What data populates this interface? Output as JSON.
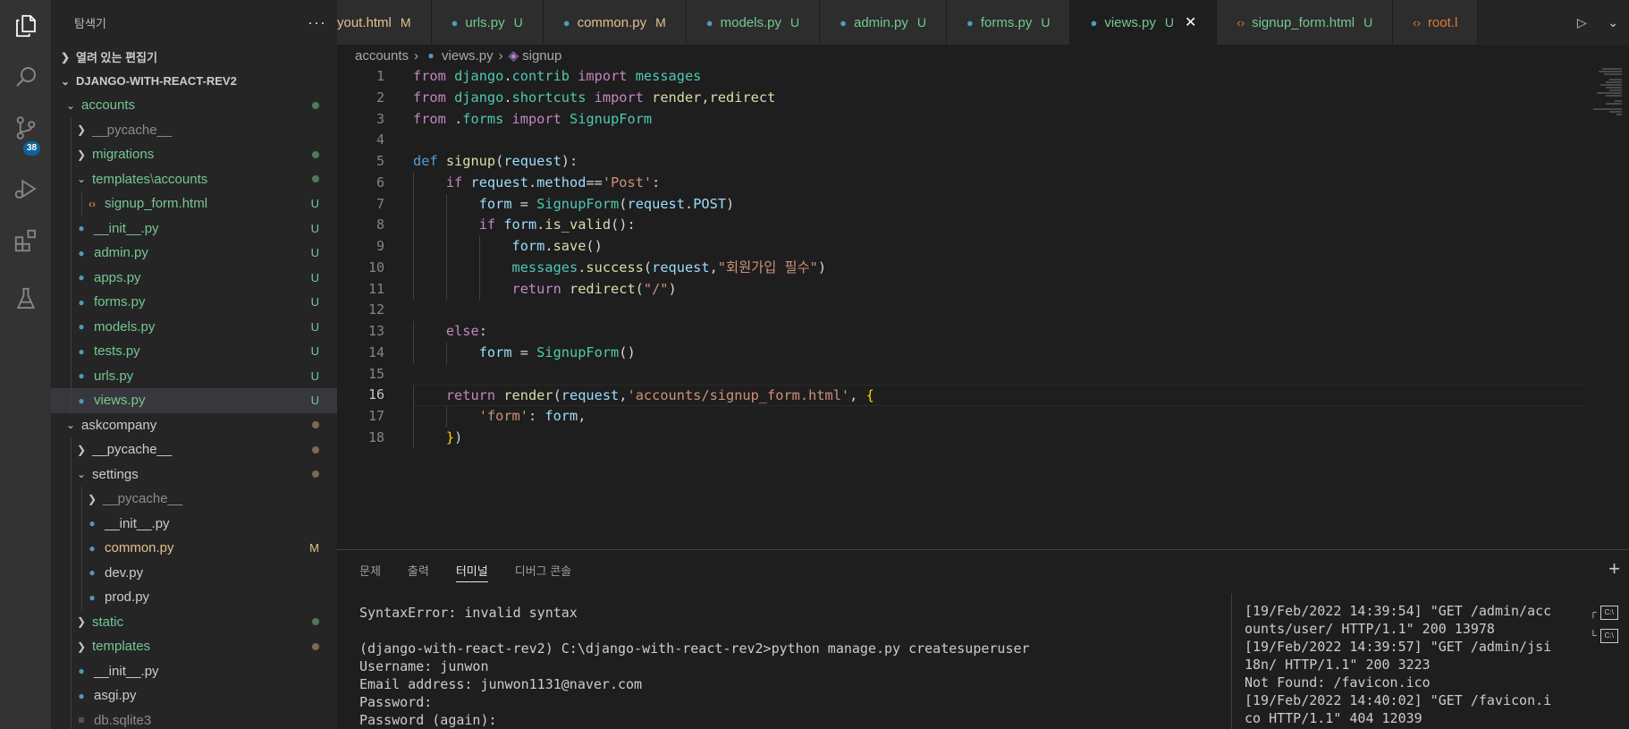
{
  "activity_bar": {
    "items": [
      {
        "name": "explorer-icon"
      },
      {
        "name": "search-icon"
      },
      {
        "name": "source-control-icon",
        "badge": "38"
      },
      {
        "name": "run-debug-icon"
      },
      {
        "name": "extensions-icon"
      },
      {
        "name": "testing-icon"
      }
    ]
  },
  "sidebar": {
    "title": "탐색기",
    "more": "···",
    "open_editors": "열려 있는 편집기",
    "project": "DJANGO-WITH-REACT-REV2",
    "tree": [
      {
        "label": "accounts",
        "depth": 1,
        "type": "folder-open",
        "color": "#73c991",
        "status": "dot-green"
      },
      {
        "label": "__pycache__",
        "depth": 2,
        "type": "folder",
        "color": "#8c8c8c",
        "status": ""
      },
      {
        "label": "migrations",
        "depth": 2,
        "type": "folder",
        "color": "#73c991",
        "status": "dot-green"
      },
      {
        "label": "templates",
        "label2": "accounts",
        "depth": 2,
        "type": "folder-open",
        "color": "#73c991",
        "status": "dot-green"
      },
      {
        "label": "signup_form.html",
        "depth": 3,
        "type": "html",
        "color": "#73c991",
        "status": "U"
      },
      {
        "label": "__init__.py",
        "depth": 2,
        "type": "py",
        "color": "#73c991",
        "status": "U"
      },
      {
        "label": "admin.py",
        "depth": 2,
        "type": "py",
        "color": "#73c991",
        "status": "U"
      },
      {
        "label": "apps.py",
        "depth": 2,
        "type": "py",
        "color": "#73c991",
        "status": "U"
      },
      {
        "label": "forms.py",
        "depth": 2,
        "type": "py",
        "color": "#73c991",
        "status": "U"
      },
      {
        "label": "models.py",
        "depth": 2,
        "type": "py",
        "color": "#73c991",
        "status": "U"
      },
      {
        "label": "tests.py",
        "depth": 2,
        "type": "py",
        "color": "#73c991",
        "status": "U"
      },
      {
        "label": "urls.py",
        "depth": 2,
        "type": "py",
        "color": "#73c991",
        "status": "U"
      },
      {
        "label": "views.py",
        "depth": 2,
        "type": "py",
        "color": "#73c991",
        "status": "U",
        "selected": true
      },
      {
        "label": "askcompany",
        "depth": 1,
        "type": "folder-open",
        "color": "#cccccc",
        "status": "dot-brown"
      },
      {
        "label": "__pycache__",
        "depth": 2,
        "type": "folder",
        "color": "#cccccc",
        "status": "dot-brown"
      },
      {
        "label": "settings",
        "depth": 2,
        "type": "folder-open",
        "color": "#cccccc",
        "status": "dot-brown"
      },
      {
        "label": "__pycache__",
        "depth": 3,
        "type": "folder",
        "color": "#8c8c8c",
        "status": ""
      },
      {
        "label": "__init__.py",
        "depth": 3,
        "type": "py",
        "color": "#cccccc",
        "status": ""
      },
      {
        "label": "common.py",
        "depth": 3,
        "type": "py",
        "color": "#e2c08d",
        "status": "M"
      },
      {
        "label": "dev.py",
        "depth": 3,
        "type": "py",
        "color": "#cccccc",
        "status": ""
      },
      {
        "label": "prod.py",
        "depth": 3,
        "type": "py",
        "color": "#cccccc",
        "status": ""
      },
      {
        "label": "static",
        "depth": 2,
        "type": "folder",
        "color": "#73c991",
        "status": "dot-green"
      },
      {
        "label": "templates",
        "depth": 2,
        "type": "folder",
        "color": "#73c991",
        "status": "dot-brown"
      },
      {
        "label": "__init__.py",
        "depth": 2,
        "type": "py",
        "color": "#cccccc",
        "status": ""
      },
      {
        "label": "asgi.py",
        "depth": 2,
        "type": "py",
        "color": "#cccccc",
        "status": ""
      },
      {
        "label": "db.sqlite3",
        "depth": 2,
        "type": "db",
        "color": "#8c8c8c",
        "status": ""
      }
    ]
  },
  "tabs": [
    {
      "label": "yout.html",
      "status": "M",
      "icon": "html",
      "color": "#e2c08d",
      "active": false
    },
    {
      "label": "urls.py",
      "status": "U",
      "icon": "py",
      "color": "#73c991",
      "active": false
    },
    {
      "label": "common.py",
      "status": "M",
      "icon": "py",
      "color": "#e2c08d",
      "active": false
    },
    {
      "label": "models.py",
      "status": "U",
      "icon": "py",
      "color": "#73c991",
      "active": false
    },
    {
      "label": "admin.py",
      "status": "U",
      "icon": "py",
      "color": "#73c991",
      "active": false
    },
    {
      "label": "forms.py",
      "status": "U",
      "icon": "py",
      "color": "#73c991",
      "active": false
    },
    {
      "label": "views.py",
      "status": "U",
      "icon": "py",
      "color": "#73c991",
      "active": true
    },
    {
      "label": "signup_form.html",
      "status": "U",
      "icon": "html",
      "color": "#73c991",
      "active": false
    },
    {
      "label": "root.l",
      "status": "",
      "icon": "html",
      "color": "#e37933",
      "active": false
    }
  ],
  "breadcrumb": {
    "folder": "accounts",
    "file": "views.py",
    "symbol": "signup"
  },
  "editor": {
    "current_line": 16,
    "lines": [
      [
        [
          "k",
          "from "
        ],
        [
          "n",
          "django"
        ],
        [
          "p",
          "."
        ],
        [
          "n",
          "contrib"
        ],
        [
          "k",
          " import "
        ],
        [
          "n",
          "messages"
        ]
      ],
      [
        [
          "k",
          "from "
        ],
        [
          "n",
          "django"
        ],
        [
          "p",
          "."
        ],
        [
          "n",
          "shortcuts"
        ],
        [
          "k",
          " import "
        ],
        [
          "f",
          "render"
        ],
        [
          "p",
          ","
        ],
        [
          "f",
          "redirect"
        ]
      ],
      [
        [
          "k",
          "from "
        ],
        [
          "p",
          "."
        ],
        [
          "n",
          "forms"
        ],
        [
          "k",
          " import "
        ],
        [
          "n",
          "SignupForm"
        ]
      ],
      [],
      [
        [
          "kb",
          "def "
        ],
        [
          "f",
          "signup"
        ],
        [
          "p",
          "("
        ],
        [
          "v",
          "request"
        ],
        [
          "p",
          "):"
        ]
      ],
      [
        [
          "p",
          "    "
        ],
        [
          "k",
          "if "
        ],
        [
          "v",
          "request"
        ],
        [
          "p",
          "."
        ],
        [
          "v",
          "method"
        ],
        [
          "p",
          "=="
        ],
        [
          "s",
          "'Post'"
        ],
        [
          "p",
          ":"
        ]
      ],
      [
        [
          "p",
          "        "
        ],
        [
          "v",
          "form"
        ],
        [
          "p",
          " = "
        ],
        [
          "n",
          "SignupForm"
        ],
        [
          "p",
          "("
        ],
        [
          "v",
          "request"
        ],
        [
          "p",
          "."
        ],
        [
          "v",
          "POST"
        ],
        [
          "p",
          ")"
        ]
      ],
      [
        [
          "p",
          "        "
        ],
        [
          "k",
          "if "
        ],
        [
          "v",
          "form"
        ],
        [
          "p",
          "."
        ],
        [
          "f",
          "is_valid"
        ],
        [
          "p",
          "():"
        ]
      ],
      [
        [
          "p",
          "            "
        ],
        [
          "v",
          "form"
        ],
        [
          "p",
          "."
        ],
        [
          "f",
          "save"
        ],
        [
          "p",
          "()"
        ]
      ],
      [
        [
          "p",
          "            "
        ],
        [
          "n",
          "messages"
        ],
        [
          "p",
          "."
        ],
        [
          "f",
          "success"
        ],
        [
          "p",
          "("
        ],
        [
          "v",
          "request"
        ],
        [
          "p",
          ","
        ],
        [
          "s",
          "\"회원가입 필수\""
        ],
        [
          "p",
          ")"
        ]
      ],
      [
        [
          "p",
          "            "
        ],
        [
          "k",
          "return "
        ],
        [
          "f",
          "redirect"
        ],
        [
          "p",
          "("
        ],
        [
          "s",
          "\"/\""
        ],
        [
          "p",
          ")"
        ]
      ],
      [],
      [
        [
          "p",
          "    "
        ],
        [
          "k",
          "else"
        ],
        [
          "p",
          ":"
        ]
      ],
      [
        [
          "p",
          "        "
        ],
        [
          "v",
          "form"
        ],
        [
          "p",
          " = "
        ],
        [
          "n",
          "SignupForm"
        ],
        [
          "p",
          "()"
        ]
      ],
      [],
      [
        [
          "p",
          "    "
        ],
        [
          "k",
          "return "
        ],
        [
          "f",
          "render"
        ],
        [
          "p",
          "("
        ],
        [
          "v",
          "request"
        ],
        [
          "p",
          ","
        ],
        [
          "s",
          "'accounts/signup_form.html'"
        ],
        [
          "p",
          ", "
        ],
        [
          "br",
          "{"
        ]
      ],
      [
        [
          "p",
          "        "
        ],
        [
          "s",
          "'form'"
        ],
        [
          "p",
          ": "
        ],
        [
          "v",
          "form"
        ],
        [
          "p",
          ","
        ]
      ],
      [
        [
          "p",
          "    "
        ],
        [
          "br",
          "}"
        ],
        [
          "p",
          ")"
        ]
      ]
    ]
  },
  "panel": {
    "tabs": [
      {
        "label": "문제",
        "active": false
      },
      {
        "label": "출력",
        "active": false
      },
      {
        "label": "터미널",
        "active": true
      },
      {
        "label": "디버그 콘솔",
        "active": false
      }
    ],
    "plus": "+",
    "terminal_left": [
      "SyntaxError: invalid syntax",
      "",
      "(django-with-react-rev2) C:\\django-with-react-rev2>python manage.py createsuperuser",
      "Username: junwon",
      "Email address: junwon1131@naver.com",
      "Password:",
      "Password (again):"
    ],
    "terminal_right": [
      "[19/Feb/2022 14:39:54] \"GET /admin/acc",
      "ounts/user/ HTTP/1.1\" 200 13978",
      "[19/Feb/2022 14:39:57] \"GET /admin/jsi",
      "18n/ HTTP/1.1\" 200 3223",
      "Not Found: /favicon.ico",
      "[19/Feb/2022 14:40:02] \"GET /favicon.i",
      "co HTTP/1.1\" 404 12039"
    ],
    "terminal_list": [
      {
        "label": "C:\\"
      },
      {
        "label": "C:\\"
      }
    ]
  },
  "colors": {
    "untracked": "#73c991",
    "modified": "#e2c08d",
    "badge": "#0e639c"
  }
}
